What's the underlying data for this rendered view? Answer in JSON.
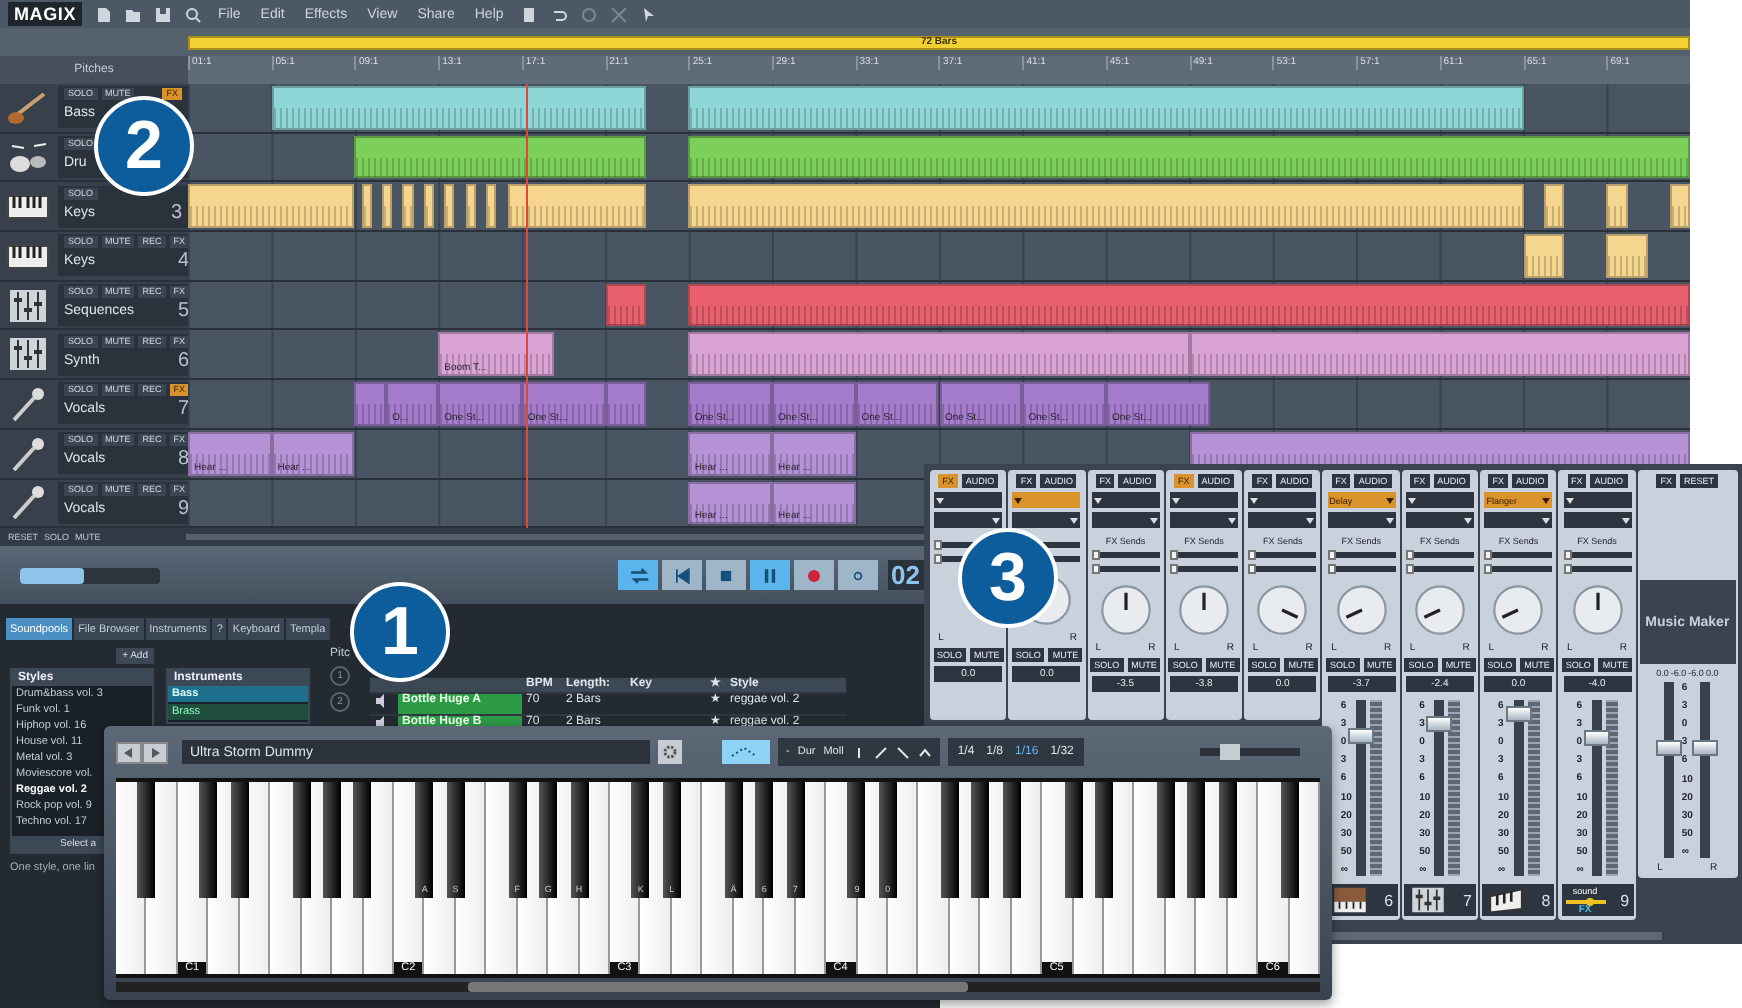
{
  "menu_bar": {
    "logo": "MAGIX",
    "menu": [
      "File",
      "Edit",
      "Effects",
      "View",
      "Share",
      "Help"
    ]
  },
  "arranger": {
    "loop_label": "72 Bars",
    "column_label": "Pitches",
    "ruler": [
      "01:1",
      "05:1",
      "09:1",
      "13:1",
      "17:1",
      "21:1",
      "25:1",
      "29:1",
      "33:1",
      "37:1",
      "41:1",
      "45:1",
      "49:1",
      "53:1",
      "57:1",
      "61:1",
      "65:1",
      "69:1"
    ],
    "playhead": {
      "level": 0.225
    },
    "tracks": [
      {
        "name": "Bass",
        "kind": "guitar",
        "color": "#8fd6d6",
        "buttons": [
          {
            "label": "SOLO",
            "on": false
          },
          {
            "label": "MUTE",
            "on": false
          },
          {
            "label": "FX",
            "on": true
          }
        ]
      },
      {
        "name": "Dru",
        "kind": "drums",
        "color": "#7ccf5a",
        "buttons": [
          {
            "label": "SOLO",
            "on": false
          }
        ]
      },
      {
        "name": "Keys",
        "number": "3",
        "kind": "keys",
        "color": "#f6d68e",
        "buttons": [
          {
            "label": "SOLO",
            "on": false
          }
        ]
      },
      {
        "name": "Keys",
        "number": "4",
        "kind": "keys",
        "color": "#f6d68e",
        "buttons": [
          {
            "label": "SOLO",
            "on": false
          },
          {
            "label": "MUTE",
            "on": false
          },
          {
            "label": "REC",
            "on": false
          },
          {
            "label": "FX",
            "on": false
          }
        ]
      },
      {
        "name": "Sequences",
        "number": "5",
        "kind": "faders",
        "color": "#e8606e",
        "buttons": [
          {
            "label": "SOLO",
            "on": false
          },
          {
            "label": "MUTE",
            "on": false
          },
          {
            "label": "REC",
            "on": false
          },
          {
            "label": "FX",
            "on": false
          }
        ]
      },
      {
        "name": "Synth",
        "number": "6",
        "kind": "faders",
        "color": "#d9a3d6",
        "clip_labels": [
          "Boom T..."
        ],
        "buttons": [
          {
            "label": "SOLO",
            "on": false
          },
          {
            "label": "MUTE",
            "on": false
          },
          {
            "label": "REC",
            "on": false
          },
          {
            "label": "FX",
            "on": false
          }
        ]
      },
      {
        "name": "Vocals",
        "number": "7",
        "kind": "mic",
        "color": "#a57ccc",
        "clip_labels": [
          "O...",
          "One St...",
          "One St...",
          "One St...",
          "One St...",
          "One St...",
          "One St...",
          "One St...",
          "One St..."
        ],
        "buttons": [
          {
            "label": "SOLO",
            "on": false
          },
          {
            "label": "MUTE",
            "on": false
          },
          {
            "label": "REC",
            "on": false
          },
          {
            "label": "FX",
            "on": true
          }
        ]
      },
      {
        "name": "Vocals",
        "number": "8",
        "kind": "mic",
        "color": "#b592d6",
        "clip_labels": [
          "Hear ...",
          "Hear ...",
          "Hear ...",
          "Hear ..."
        ],
        "buttons": [
          {
            "label": "SOLO",
            "on": false
          },
          {
            "label": "MUTE",
            "on": false
          },
          {
            "label": "REC",
            "on": false
          },
          {
            "label": "FX",
            "on": false
          }
        ]
      },
      {
        "name": "Vocals",
        "number": "9",
        "kind": "mic",
        "color": "#b592d6",
        "clip_labels": [
          "Hear ...",
          "Hear ..."
        ],
        "buttons": [
          {
            "label": "SOLO",
            "on": false
          },
          {
            "label": "MUTE",
            "on": false
          },
          {
            "label": "REC",
            "on": false
          },
          {
            "label": "FX",
            "on": false
          }
        ]
      }
    ],
    "footer_buttons": [
      "RESET",
      "SOLO",
      "MUTE"
    ]
  },
  "transport": {
    "zoom": {
      "level": 0.45
    },
    "buttons": [
      {
        "kind": "loop",
        "selected": true
      },
      {
        "kind": "start",
        "selected": false
      },
      {
        "kind": "stop",
        "selected": false
      },
      {
        "kind": "pause",
        "selected": true
      },
      {
        "kind": "record",
        "selected": false
      },
      {
        "kind": "dot",
        "selected": false
      }
    ],
    "time": "02"
  },
  "browser": {
    "tabs": [
      {
        "label": "Soundpools",
        "selected": true
      },
      {
        "label": "File Browser",
        "selected": false
      },
      {
        "label": "Instruments",
        "selected": false
      },
      {
        "label": "?",
        "selected": false
      },
      {
        "label": "Keyboard",
        "selected": false
      },
      {
        "label": "Templa",
        "selected": false
      }
    ],
    "add_button": "+ Add",
    "styles": {
      "header": "Styles",
      "items": [
        {
          "label": "Drum&bass vol. 3",
          "selected": false
        },
        {
          "label": "Funk vol. 1",
          "selected": false
        },
        {
          "label": "Hiphop vol. 16",
          "selected": false
        },
        {
          "label": "House vol. 11",
          "selected": false
        },
        {
          "label": "Metal vol. 3",
          "selected": false
        },
        {
          "label": "Moviescore vol.",
          "selected": false
        },
        {
          "label": "Reggae vol. 2",
          "selected": true
        },
        {
          "label": "Rock pop vol. 9",
          "selected": false
        },
        {
          "label": "Techno vol. 17",
          "selected": false
        }
      ]
    },
    "select_button": "Select a",
    "hint": "One style, one lin",
    "instruments": {
      "header": "Instruments",
      "items": [
        {
          "label": "Bass",
          "selected": true
        },
        {
          "label": "Brass",
          "selected": false
        }
      ]
    },
    "pitch_label": "Pitc",
    "pitch_buttons": [
      "1",
      "2"
    ],
    "loops": {
      "columns": [
        "BPM",
        "Length:",
        "Key",
        "★",
        "Style"
      ],
      "rows": [
        {
          "name": "Bottle Huge A",
          "bpm": "70",
          "length": "2 Bars",
          "star": "★",
          "style": "reggae vol. 2"
        },
        {
          "name": "Bottle Huge B",
          "bpm": "70",
          "length": "2 Bars",
          "star": "★",
          "style": "reggae vol. 2"
        }
      ]
    }
  },
  "mixer": {
    "channels": [
      {
        "fx": {
          "label": "FX",
          "on": true
        },
        "audio": "AUDIO",
        "insert": {
          "on": false
        },
        "sends": [
          {
            "level": 0
          },
          {
            "level": 0
          }
        ],
        "pan_labels": {
          "left": "L"
        },
        "solo": "SOLO",
        "mute": "MUTE",
        "readout": "0.0"
      },
      {
        "fx": {
          "label": "FX",
          "on": false
        },
        "audio": "AUDIO",
        "insert": {
          "on": true
        },
        "sends": [
          {
            "level": 0
          },
          {
            "level": 0
          }
        ],
        "pan_labels": {
          "right": "R"
        },
        "solo": "SOLO",
        "mute": "MUTE",
        "readout": "0.0"
      },
      {
        "fx": {
          "label": "FX",
          "on": false
        },
        "audio": "AUDIO",
        "insert": {
          "on": false
        },
        "sends_label": "FX Sends",
        "sends": [
          {
            "level": 0
          },
          {
            "level": 0
          }
        ],
        "pan": {
          "left": false,
          "right": false
        },
        "pan_labels": {
          "left": "L",
          "right": "R"
        },
        "solo": "SOLO",
        "mute": "MUTE",
        "readout": "-3.5"
      },
      {
        "fx": {
          "label": "FX",
          "on": true
        },
        "audio": "AUDIO",
        "insert": {
          "on": false
        },
        "sends_label": "FX Sends",
        "sends": [
          {
            "level": 0
          },
          {
            "level": 0
          }
        ],
        "pan": {
          "left": false,
          "right": false
        },
        "pan_labels": {
          "left": "L",
          "right": "R"
        },
        "solo": "SOLO",
        "mute": "MUTE",
        "readout": "-3.8"
      },
      {
        "fx": {
          "label": "FX",
          "on": false
        },
        "audio": "AUDIO",
        "insert": {
          "on": false
        },
        "sends_label": "FX Sends",
        "sends": [
          {
            "level": 0
          },
          {
            "level": 0
          }
        ],
        "pan": {
          "left": false,
          "right": true
        },
        "pan_labels": {
          "left": "L",
          "right": "R"
        },
        "solo": "SOLO",
        "mute": "MUTE",
        "readout": "0.0"
      },
      {
        "fx": {
          "label": "FX",
          "on": false
        },
        "audio": "AUDIO",
        "insert": {
          "on": true,
          "label": "Delay"
        },
        "sends_label": "FX Sends",
        "sends": [
          {
            "level": 0
          },
          {
            "level": 0
          }
        ],
        "pan": {
          "left": true,
          "right": false
        },
        "pan_labels": {
          "left": "L",
          "right": "R"
        },
        "solo": "SOLO",
        "mute": "MUTE",
        "readout": "-3.7",
        "scale": [
          "6",
          "3",
          "0",
          "3",
          "6",
          "10",
          "20",
          "30",
          "50",
          "∞"
        ],
        "fader": {
          "level": 0.8
        },
        "number": "6",
        "kind": "organ"
      },
      {
        "fx": {
          "label": "FX",
          "on": false
        },
        "audio": "AUDIO",
        "insert": {
          "on": false
        },
        "sends_label": "FX Sends",
        "sends": [
          {
            "level": 0
          },
          {
            "level": 0
          }
        ],
        "pan": {
          "left": true,
          "right": false
        },
        "pan_labels": {
          "left": "L",
          "right": "R"
        },
        "solo": "SOLO",
        "mute": "MUTE",
        "readout": "-2.4",
        "scale": [
          "6",
          "3",
          "0",
          "3",
          "6",
          "10",
          "20",
          "30",
          "50",
          "∞"
        ],
        "fader": {
          "level": 0.86
        },
        "number": "7",
        "kind": "faders"
      },
      {
        "fx": {
          "label": "FX",
          "on": false
        },
        "audio": "AUDIO",
        "insert": {
          "on": true,
          "label": "Flanger"
        },
        "sends_label": "FX Sends",
        "sends": [
          {
            "level": 0
          },
          {
            "level": 0
          }
        ],
        "pan": {
          "left": true,
          "right": false
        },
        "pan_labels": {
          "left": "L",
          "right": "R"
        },
        "solo": "SOLO",
        "mute": "MUTE",
        "readout": "0.0",
        "scale": [
          "6",
          "3",
          "0",
          "3",
          "6",
          "10",
          "20",
          "30",
          "50",
          "∞"
        ],
        "fader": {
          "level": 0.92
        },
        "number": "8",
        "kind": "keys"
      },
      {
        "fx": {
          "label": "FX",
          "on": false
        },
        "audio": "AUDIO",
        "insert": {
          "on": false
        },
        "sends_label": "FX Sends",
        "sends": [
          {
            "level": 0
          },
          {
            "level": 0
          }
        ],
        "pan": {
          "left": false,
          "right": false
        },
        "pan_labels": {
          "left": "L",
          "right": "R"
        },
        "solo": "SOLO",
        "mute": "MUTE",
        "readout": "-4.0",
        "scale": [
          "6",
          "3",
          "0",
          "3",
          "6",
          "10",
          "20",
          "30",
          "50",
          "∞"
        ],
        "fader": {
          "level": 0.78
        },
        "number": "9",
        "kind": "soundfx",
        "logo_words": [
          "sound",
          "FX"
        ]
      }
    ],
    "master": {
      "buttons": [
        "FX",
        "RESET"
      ],
      "logo": "Music Maker",
      "readouts": [
        "0.0",
        "-6.0",
        "-6.0",
        "0.0"
      ],
      "scale": [
        "6",
        "3",
        "0",
        "3",
        "6",
        "10",
        "20",
        "30",
        "50",
        "∞"
      ],
      "faders": [
        {
          "level": 0.62
        },
        {
          "level": 0.62
        }
      ],
      "labels": [
        "L",
        "R"
      ]
    }
  },
  "keyboard": {
    "preset": "Ultra Storm Dummy",
    "chord_labels": [
      "-",
      "Dur",
      "Moll"
    ],
    "quantize": [
      {
        "label": "1/4",
        "selected": false
      },
      {
        "label": "1/8",
        "selected": false
      },
      {
        "label": "1/16",
        "selected": true
      },
      {
        "label": "1/32",
        "selected": false
      }
    ],
    "volume": {
      "level": 0.3
    },
    "octave_labels": [
      "C1",
      "C2",
      "C3",
      "C4",
      "C5",
      "C6"
    ],
    "key_labels": [
      "A",
      "S",
      "F",
      "G",
      "H",
      "K",
      "L",
      "Ä",
      "6",
      "7",
      "9",
      "0"
    ]
  },
  "badges": [
    "1",
    "2",
    "3"
  ]
}
